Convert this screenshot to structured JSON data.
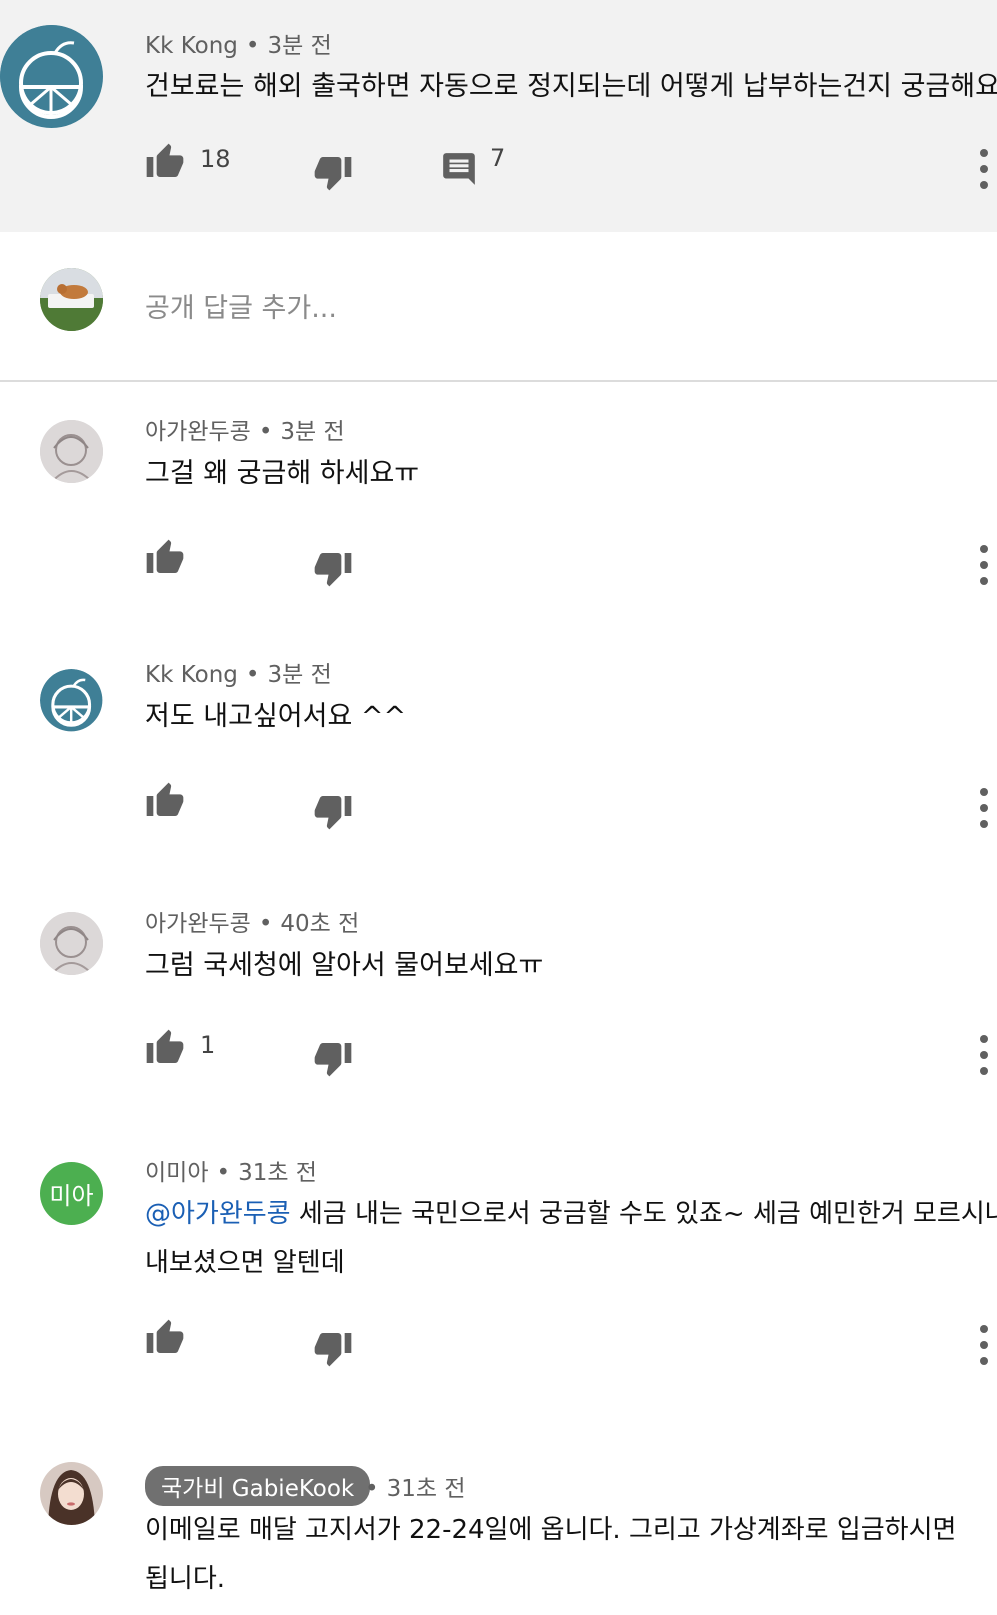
{
  "parent_comment": {
    "author": "Kk Kong",
    "time": "3분 전",
    "text": "건보료는 해외 출국하면 자동으로 정지되는데 어떻게 납부하는건지 궁금해요",
    "likes": "18",
    "replies": "7"
  },
  "reply_box": {
    "placeholder": "공개 답글 추가..."
  },
  "replies": [
    {
      "author": "아가완두콩",
      "time": "3분 전",
      "text": "그걸 왜 궁금해 하세요ㅠ",
      "likes": ""
    },
    {
      "author": "Kk Kong",
      "time": "3분 전",
      "text": "저도 내고싶어서요 ^^",
      "likes": ""
    },
    {
      "author": "아가완두콩",
      "time": "40초 전",
      "text": "그럼 국세청에 알아서 물어보세요ㅠ",
      "likes": "1"
    },
    {
      "author": "이미아",
      "avatar_text": "미아",
      "time": "31초 전",
      "mention": "@아가완두콩",
      "text_line1": " 세금 내는 국민으로서 궁금할 수도 있죠~ 세금 예민한거 모르시나요",
      "text_line2": "내보셨으면 알텐데",
      "likes": ""
    },
    {
      "author": "국가비 GabieKook",
      "time": "31초 전",
      "text_line1": "이메일로 매달 고지서가 22-24일에 옵니다. 그리고 가상계좌로 입금하시면",
      "text_line2": "됩니다."
    }
  ],
  "dot": "•",
  "colors": {
    "parent_bg": "#f2f2f2",
    "mention": "#1a5fb4",
    "avatar_green": "#4caf50",
    "badge_bg": "#707070"
  }
}
